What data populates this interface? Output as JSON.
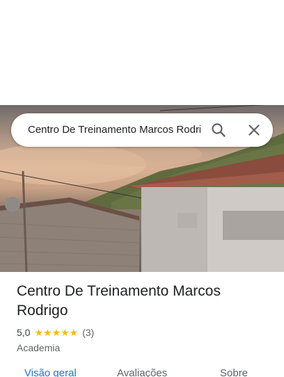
{
  "search": {
    "query": "Centro De Treinamento Marcos Rodrigo"
  },
  "place": {
    "title": "Centro De Treinamento Marcos Rodrigo",
    "rating": "5,0",
    "stars": "★★★★★",
    "review_count": "(3)",
    "category": "Academia"
  },
  "tabs": [
    {
      "label": "Visão geral",
      "active": true
    },
    {
      "label": "Avaliações",
      "active": false
    },
    {
      "label": "Sobre",
      "active": false
    }
  ],
  "colors": {
    "accent": "#1a73e8",
    "star": "#fbbc04"
  },
  "icons": {
    "search": "search-icon",
    "close": "close-icon",
    "star": "star-icon"
  }
}
